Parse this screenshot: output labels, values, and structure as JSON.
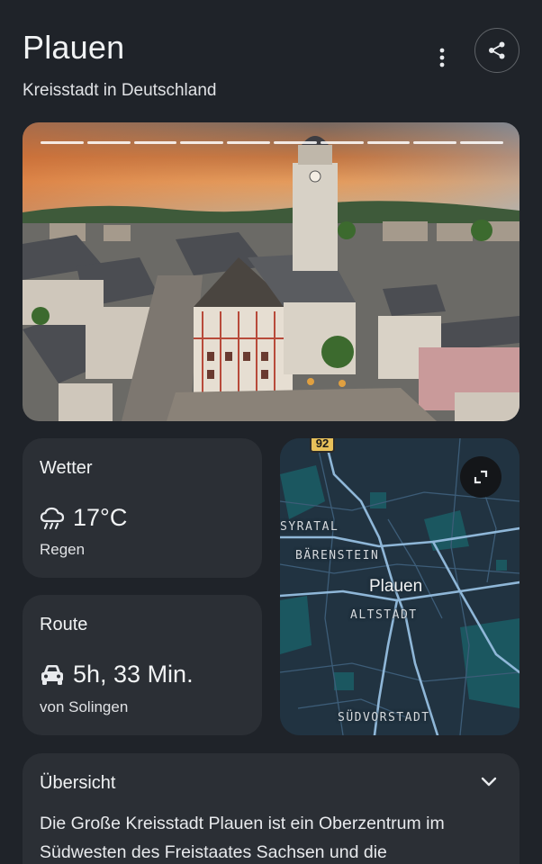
{
  "header": {
    "title": "Plauen",
    "subtitle": "Kreisstadt in Deutschland",
    "more_icon": "more-vert-icon",
    "share_icon": "share-icon"
  },
  "hero": {
    "progress_segments": 10,
    "image_description_icon": "city-photo"
  },
  "weather": {
    "title": "Wetter",
    "icon": "rain-cloud-icon",
    "temperature": "17°C",
    "condition": "Regen"
  },
  "route": {
    "title": "Route",
    "icon": "car-icon",
    "duration": "5h, 33 Min.",
    "origin": "von Solingen"
  },
  "map": {
    "route_number": "92",
    "labels": {
      "syratal": "SYRATAL",
      "baerenstein": "BÄRENSTEIN",
      "city": "Plauen",
      "altstadt": "ALTSTADT",
      "suedvorstadt": "SÜDVORSTADT"
    },
    "expand_icon": "expand-icon"
  },
  "overview": {
    "title": "Übersicht",
    "chevron_icon": "chevron-down-icon",
    "text": "Die Große Kreisstadt Plauen ist ein Oberzentrum im Südwesten des Freistaates Sachsen und die"
  },
  "colors": {
    "background": "#1f2329",
    "card": "#2b2f35",
    "map_bg": "#213341",
    "map_roads": "#8fb7d8",
    "shield": "#e8c15a"
  }
}
